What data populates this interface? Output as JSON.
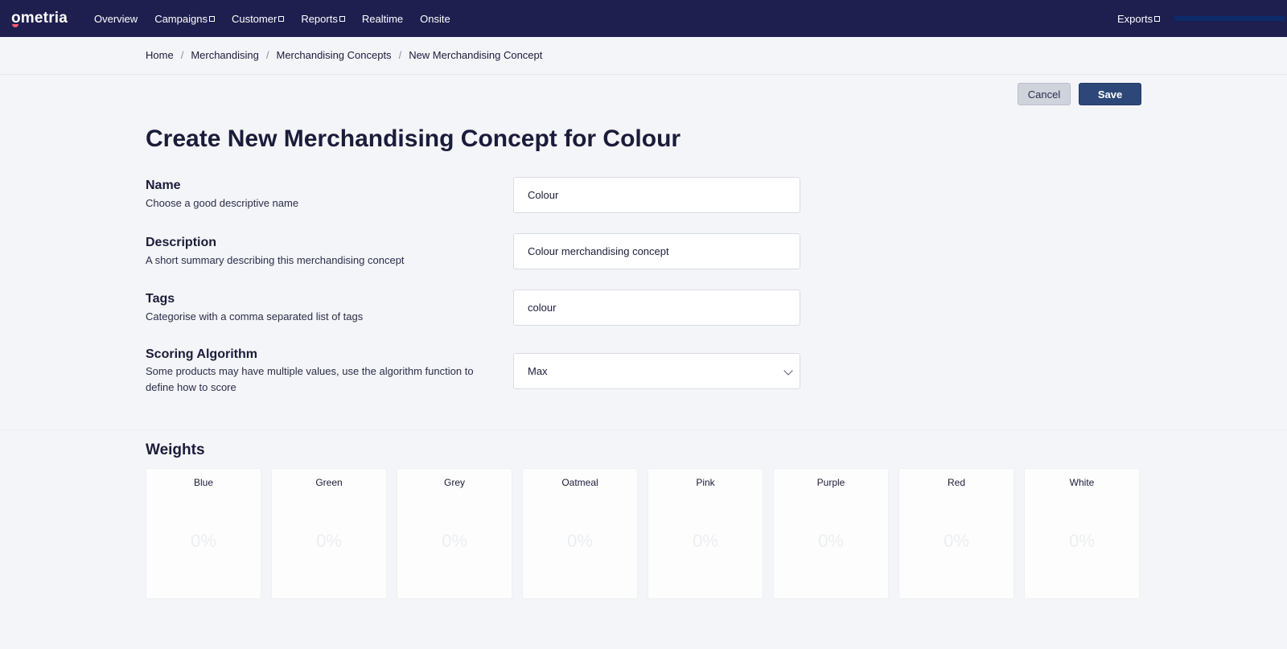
{
  "app": {
    "logo": "ometria",
    "colors": {
      "nav_bg": "#1e1f4f",
      "save_bg": "#2c4778",
      "logo_accent": "#ff5a6e"
    }
  },
  "nav": {
    "items": [
      {
        "label": "Overview",
        "external": false
      },
      {
        "label": "Campaigns",
        "external": true
      },
      {
        "label": "Customer",
        "external": true
      },
      {
        "label": "Reports",
        "external": true
      },
      {
        "label": "Realtime",
        "external": false
      },
      {
        "label": "Onsite",
        "external": false
      }
    ],
    "exports_label": "Exports"
  },
  "breadcrumb": [
    "Home",
    "Merchandising",
    "Merchandising Concepts",
    "New Merchandising Concept"
  ],
  "actions": {
    "cancel_label": "Cancel",
    "save_label": "Save"
  },
  "page_title": "Create New Merchandising Concept for Colour",
  "form": {
    "name": {
      "label": "Name",
      "help": "Choose a good descriptive name",
      "value": "Colour"
    },
    "description": {
      "label": "Description",
      "help": "A short summary describing this merchandising concept",
      "value": "Colour merchandising concept"
    },
    "tags": {
      "label": "Tags",
      "help": "Categorise with a comma separated list of tags",
      "value": "colour"
    },
    "scoring": {
      "label": "Scoring Algorithm",
      "help": "Some products may have multiple values, use the algorithm function to define how to score",
      "value": "Max"
    }
  },
  "weights": {
    "title": "Weights",
    "items": [
      {
        "name": "Blue",
        "value": "0%"
      },
      {
        "name": "Green",
        "value": "0%"
      },
      {
        "name": "Grey",
        "value": "0%"
      },
      {
        "name": "Oatmeal",
        "value": "0%"
      },
      {
        "name": "Pink",
        "value": "0%"
      },
      {
        "name": "Purple",
        "value": "0%"
      },
      {
        "name": "Red",
        "value": "0%"
      },
      {
        "name": "White",
        "value": "0%"
      }
    ]
  }
}
